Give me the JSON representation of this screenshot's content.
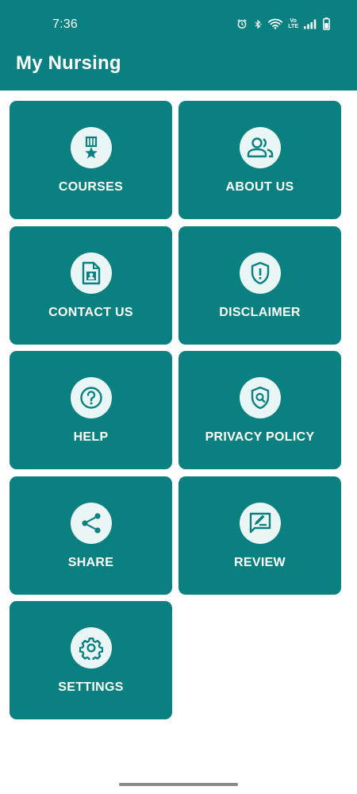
{
  "status_bar": {
    "time": "7:36",
    "volte_top": "Vo",
    "volte_bottom": "LTE"
  },
  "app_bar": {
    "title": "My Nursing"
  },
  "tiles": [
    {
      "label": "COURSES",
      "icon": "medal-icon"
    },
    {
      "label": "ABOUT US",
      "icon": "people-icon"
    },
    {
      "label": "CONTACT US",
      "icon": "contact-card-icon"
    },
    {
      "label": "DISCLAIMER",
      "icon": "shield-alert-icon"
    },
    {
      "label": "HELP",
      "icon": "help-circle-icon"
    },
    {
      "label": "PRIVACY POLICY",
      "icon": "privacy-shield-icon"
    },
    {
      "label": "SHARE",
      "icon": "share-icon"
    },
    {
      "label": "REVIEW",
      "icon": "review-icon"
    },
    {
      "label": "SETTINGS",
      "icon": "gear-icon"
    }
  ],
  "colors": {
    "primary": "#0b8080",
    "icon_bg": "#eaf5f5",
    "icon_fg": "#0b8080",
    "text_on_primary": "#ffffff"
  }
}
